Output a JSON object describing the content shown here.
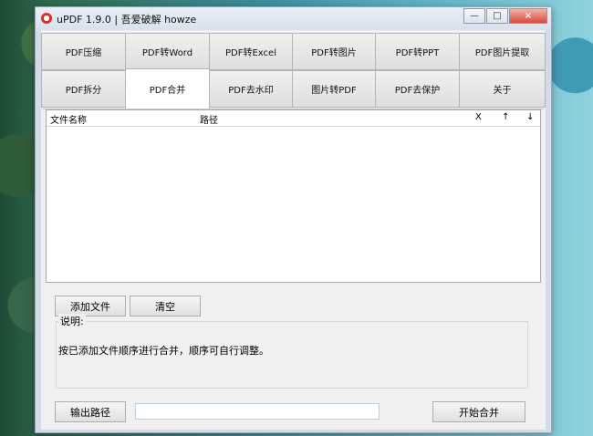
{
  "window": {
    "title": "uPDF 1.9.0 | 吾爱破解 howze",
    "app_icon": "pdf-app-icon",
    "controls": [
      "minimize",
      "maximize",
      "close"
    ]
  },
  "tabs": {
    "row1": [
      "PDF压缩",
      "PDF转Word",
      "PDF转Excel",
      "PDF转图片",
      "PDF转PPT",
      "PDF图片提取"
    ],
    "row2": [
      "PDF拆分",
      "PDF合并",
      "PDF去水印",
      "图片转PDF",
      "PDF去保护",
      "关于"
    ],
    "active": "PDF合并"
  },
  "file_list": {
    "columns": [
      "文件名称",
      "路径",
      "X",
      "↑",
      "↓"
    ],
    "rows": []
  },
  "buttons": {
    "add_files": "添加文件",
    "clear": "清空",
    "output_path": "输出路径",
    "start_merge": "开始合并"
  },
  "description": {
    "label": "说明:",
    "text": "按已添加文件顺序进行合并，顺序可自行调整。"
  },
  "output": {
    "path_value": ""
  }
}
